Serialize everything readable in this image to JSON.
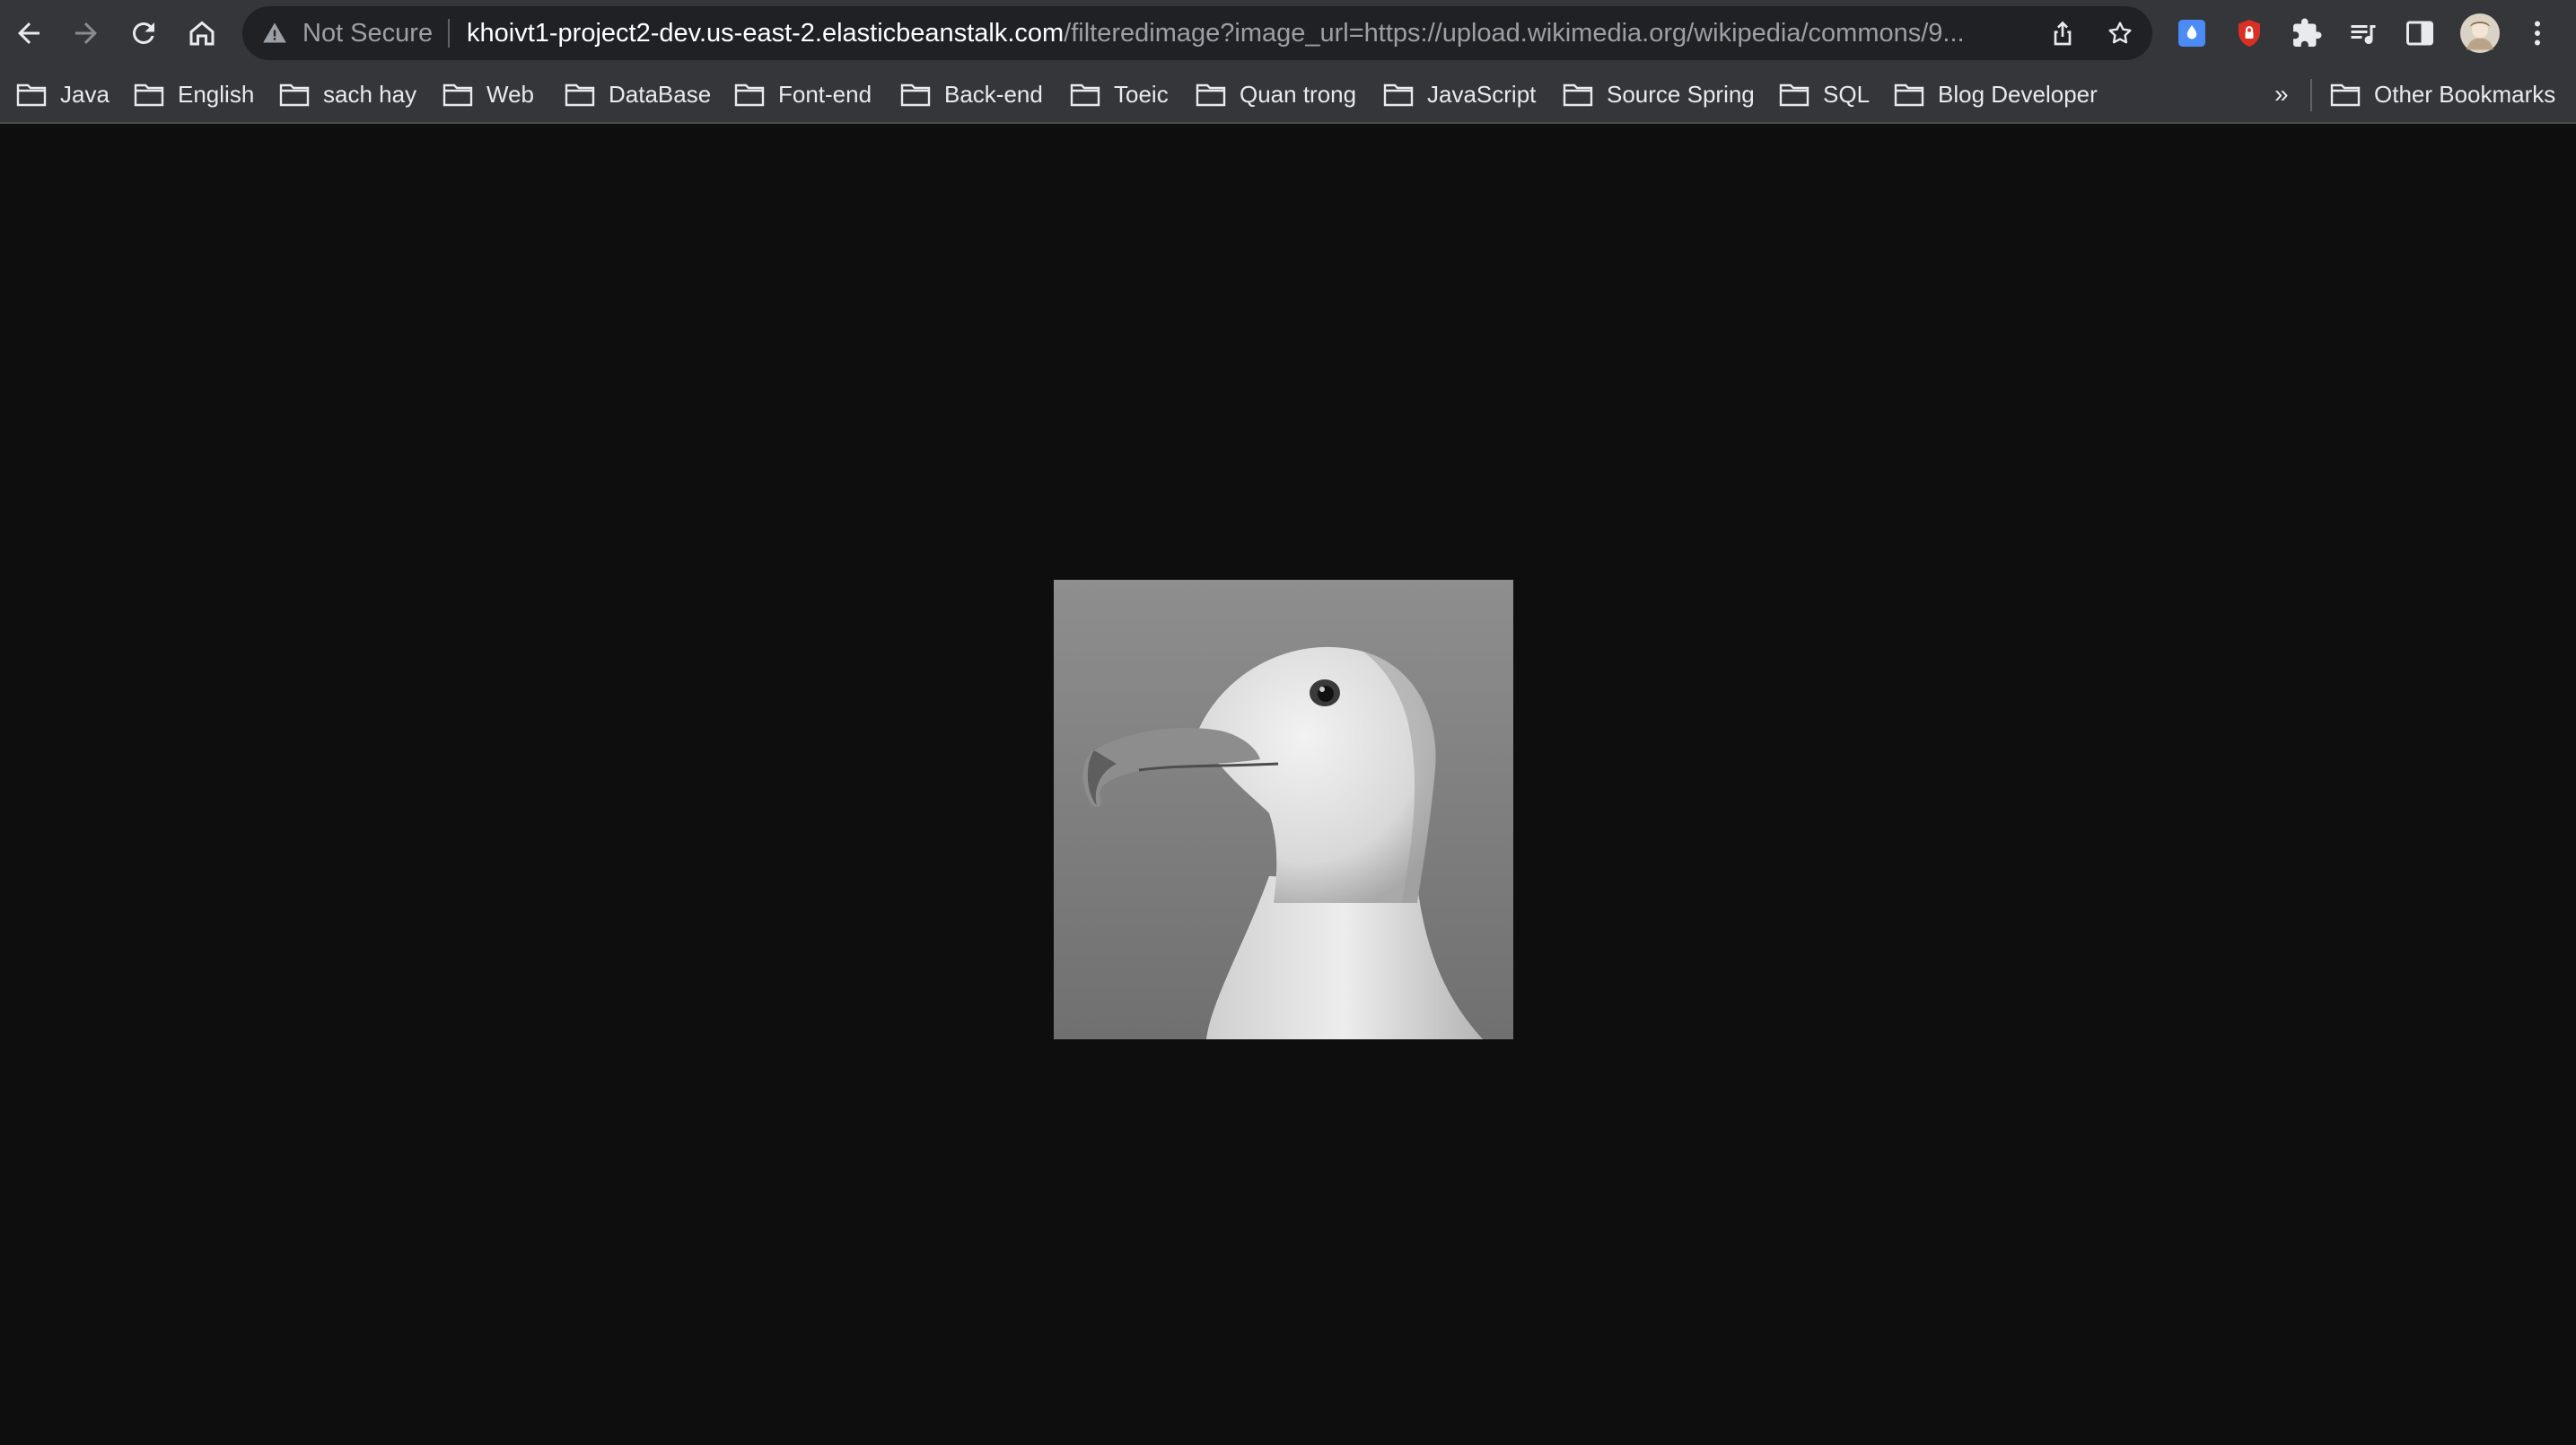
{
  "browser": {
    "security_label": "Not Secure",
    "url_host": "khoivt1-project2-dev.us-east-2.elasticbeanstalk.com",
    "url_path": "/filteredimage?image_url=https://upload.wikimedia.org/wikipedia/commons/9..."
  },
  "bookmarks": [
    {
      "label": "Java"
    },
    {
      "label": "English"
    },
    {
      "label": "sach hay"
    },
    {
      "label": "Web"
    },
    {
      "label": "DataBase"
    },
    {
      "label": "Font-end"
    },
    {
      "label": "Back-end"
    },
    {
      "label": "Toeic"
    },
    {
      "label": "Quan trong"
    },
    {
      "label": "JavaScript"
    },
    {
      "label": "Source Spring"
    },
    {
      "label": "SQL"
    },
    {
      "label": "Blog Developer"
    }
  ],
  "bookmarks_overflow": "»",
  "other_bookmarks": "Other Bookmarks",
  "icons": {
    "back": "arrow-left-icon",
    "forward": "arrow-right-icon",
    "reload": "reload-icon",
    "home": "home-icon",
    "warning": "warning-triangle-icon",
    "share": "share-icon",
    "bookmark_star": "star-icon",
    "extension_1": "droplet-icon",
    "extension_2": "shield-lock-icon",
    "extensions": "puzzle-icon",
    "reading_list": "reading-list-icon",
    "side_panel": "side-panel-icon",
    "profile": "avatar",
    "menu": "kebab-menu-icon"
  },
  "colors": {
    "toolbar_bg": "#35363a",
    "omnibox_bg": "#202124",
    "page_bg": "#0e0e0e",
    "ext_blue": "#4c8bf5",
    "ext_red": "#d93025"
  },
  "content": {
    "image_subject": "grayscale gull head"
  }
}
